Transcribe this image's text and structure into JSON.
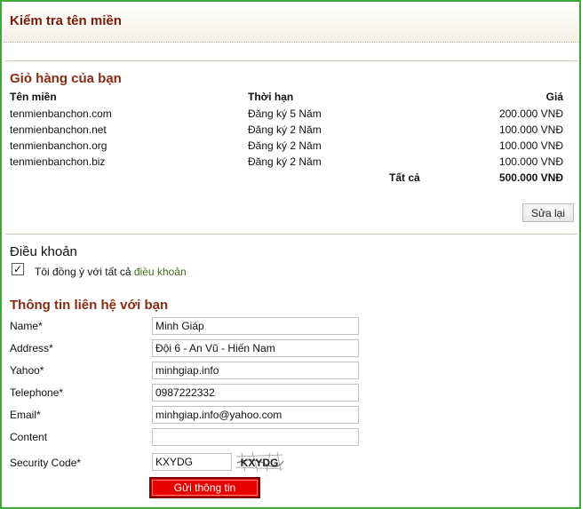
{
  "header": {
    "title": "Kiểm tra tên miền"
  },
  "cart": {
    "title": "Giỏ hàng của bạn",
    "columns": {
      "domain": "Tên miền",
      "period": "Thời hạn",
      "price": "Giá"
    },
    "rows": [
      {
        "domain": "tenmienbanchon.com",
        "period": "Đăng ký 5 Năm",
        "price": "200.000 VNĐ"
      },
      {
        "domain": "tenmienbanchon.net",
        "period": "Đăng ký 2 Năm",
        "price": "100.000 VNĐ"
      },
      {
        "domain": "tenmienbanchon.org",
        "period": "Đăng ký 2 Năm",
        "price": "100.000 VNĐ"
      },
      {
        "domain": "tenmienbanchon.biz",
        "period": "Đăng ký 2 Năm",
        "price": "100.000 VNĐ"
      }
    ],
    "total_label": "Tất cả",
    "total_value": "500.000 VNĐ",
    "edit_label": "Sửa lại"
  },
  "terms": {
    "title": "Điều khoản",
    "checked": true,
    "agree_text": "Tôi đồng ý với tất cả ",
    "link_text": "điều khoản"
  },
  "contact": {
    "title": "Thông tin liên hệ với bạn",
    "name_label": "Name*",
    "name_value": "Minh Giáp",
    "address_label": "Address*",
    "address_value": "Đội 6 - An Vũ - Hiến Nam",
    "yahoo_label": "Yahoo*",
    "yahoo_value": "minhgiap.info",
    "telephone_label": "Telephone*",
    "telephone_value": "0987222332",
    "email_label": "Email*",
    "email_value": "minhgiap.info@yahoo.com",
    "content_label": "Content",
    "content_value": "",
    "security_label": "Security Code*",
    "security_value": "KXYDG",
    "captcha_text": "KXYDG",
    "submit_label": "Gửi thông tin"
  },
  "colors": {
    "frame": "#3fa83b",
    "title": "#7a1b0c",
    "section": "#8b2a12",
    "submit": "#e80000",
    "link": "#3c6e1e"
  }
}
